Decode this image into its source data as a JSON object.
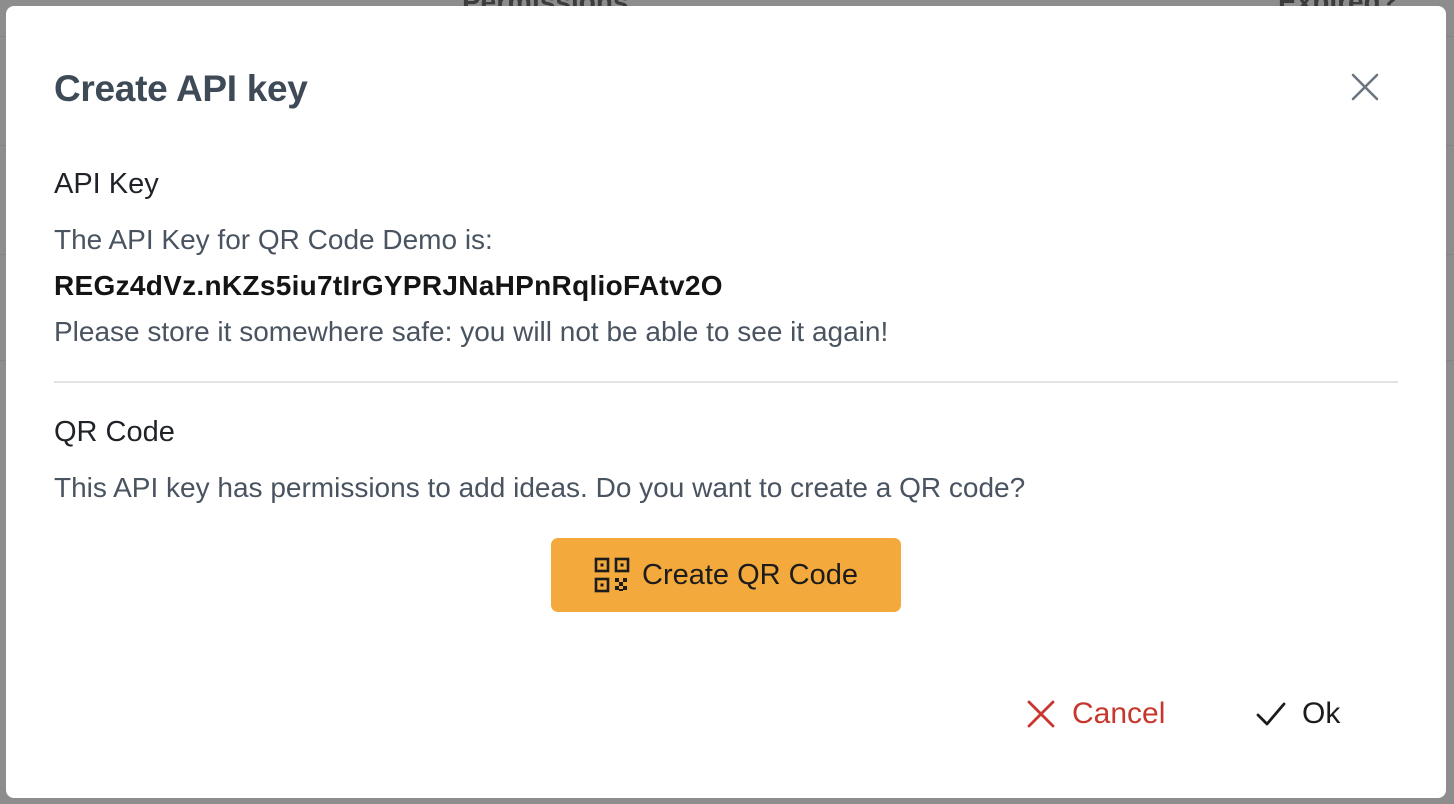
{
  "background": {
    "headers": [
      "Permissions",
      "Expired?"
    ]
  },
  "modal": {
    "title": "Create API key",
    "close_icon": "close-icon",
    "api_key_section": {
      "title": "API Key",
      "intro": "The API Key for QR Code Demo is:",
      "key": "REGz4dVz.nKZs5iu7tIrGYPRJNaHPnRqlioFAtv2O",
      "warning": "Please store it somewhere safe: you will not be able to see it again!"
    },
    "qr_section": {
      "title": "QR Code",
      "description": "This API key has permissions to add ideas. Do you want to create a QR code?",
      "button_label": "Create QR Code",
      "button_icon": "qr-code-icon"
    },
    "footer": {
      "cancel_label": "Cancel",
      "cancel_icon": "close-icon",
      "ok_label": "Ok",
      "ok_icon": "check-icon"
    }
  },
  "colors": {
    "accent": "#f3a93b",
    "danger": "#c8372d",
    "title": "#3e4a56",
    "backdrop": "#8d8d8d"
  }
}
